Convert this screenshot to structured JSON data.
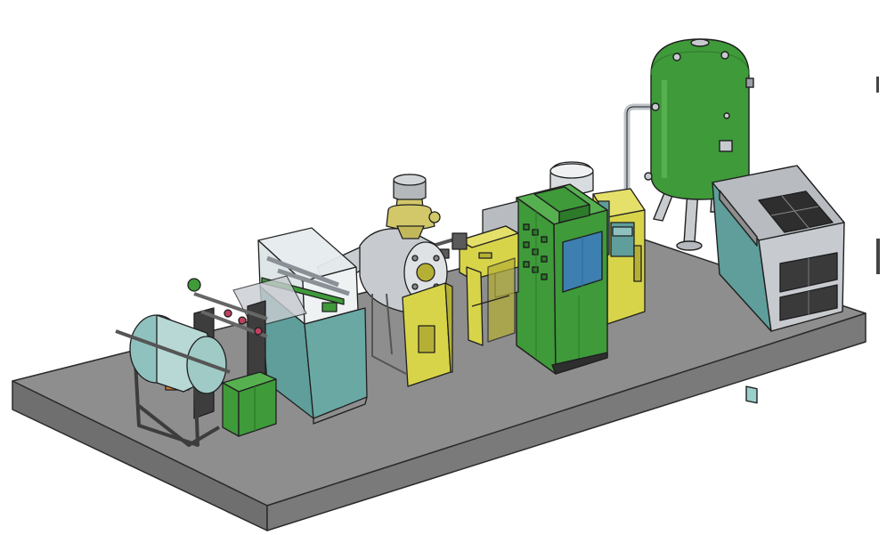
{
  "scene": {
    "palette": {
      "platform_top": "#8e8e8e",
      "platform_side": "#6f6f6f",
      "platform_front": "#7a7a7a",
      "outline": "#2a2a2a",
      "teal": "#5f9e9a",
      "teal_light": "#8fc2bf",
      "green": "#3f9a3a",
      "green_dark": "#2c7a2a",
      "green_light": "#57b050",
      "yellow": "#d8d44a",
      "yellow_dark": "#b5b035",
      "steel": "#c7cbd0",
      "steel_dark": "#9aa0a6",
      "blue_panel": "#3d7fb0",
      "dark_grille": "#2e2e2e",
      "orange": "#d47a2a"
    },
    "components": [
      {
        "id": "unwind-roll",
        "icon": "film-roll-icon"
      },
      {
        "id": "control-box-small",
        "icon": "electrical-box-icon"
      },
      {
        "id": "corona-treater",
        "icon": "treater-cabinet-icon"
      },
      {
        "id": "drum-roller",
        "icon": "drum-icon"
      },
      {
        "id": "hopper",
        "icon": "hopper-icon"
      },
      {
        "id": "extruder",
        "icon": "extruder-icon"
      },
      {
        "id": "main-control-cabinet",
        "icon": "control-cabinet-icon"
      },
      {
        "id": "motor-cabinet",
        "icon": "motor-cabinet-icon"
      },
      {
        "id": "air-receiver-tank",
        "icon": "pressure-tank-icon"
      },
      {
        "id": "air-compressor",
        "icon": "compressor-icon"
      }
    ]
  }
}
